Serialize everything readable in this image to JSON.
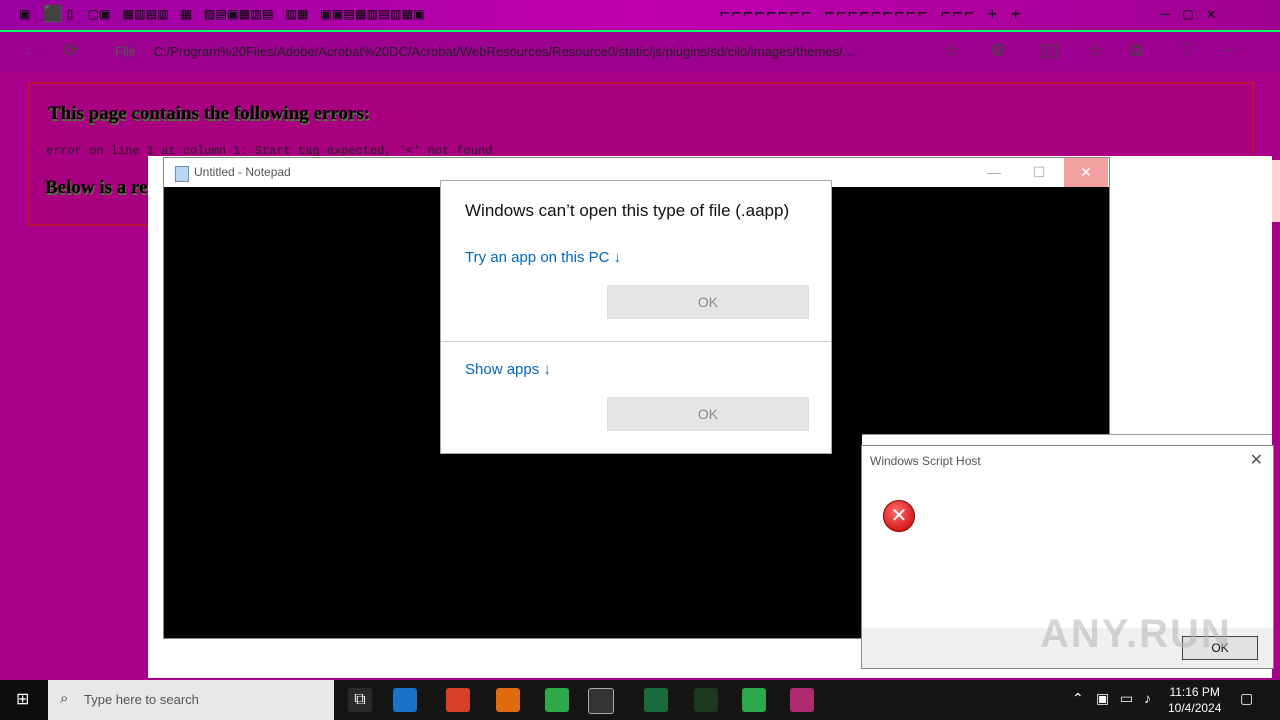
{
  "browser": {
    "address_file_tag": "File",
    "address_url": "C:/Program%20Files/Adobe/Acrobat%20DC/Acrobat/WebResources/Resource0/static/js/plugins/sd/cilo/images/themes/..."
  },
  "xml_error": {
    "title": "This page contains the following errors:",
    "line": "error on line 1 at column 1: Start tag expected, '<' not found",
    "below": "Below is a ren"
  },
  "notepad": {
    "title": "Untitled - Notepad"
  },
  "open_dialog": {
    "heading": "Windows can’t open this type of file (.aapp)",
    "link_try": "Try an app on this PC ↓",
    "ok_1": "OK",
    "link_show": "Show apps ↓",
    "ok_2": "OK"
  },
  "wsh": {
    "title": "Windows Script Host",
    "ok": "OK"
  },
  "watermark": "ANY.RUN",
  "taskbar": {
    "search_placeholder": "Type here to search",
    "time": "11:16 PM",
    "date": "10/4/2024"
  }
}
